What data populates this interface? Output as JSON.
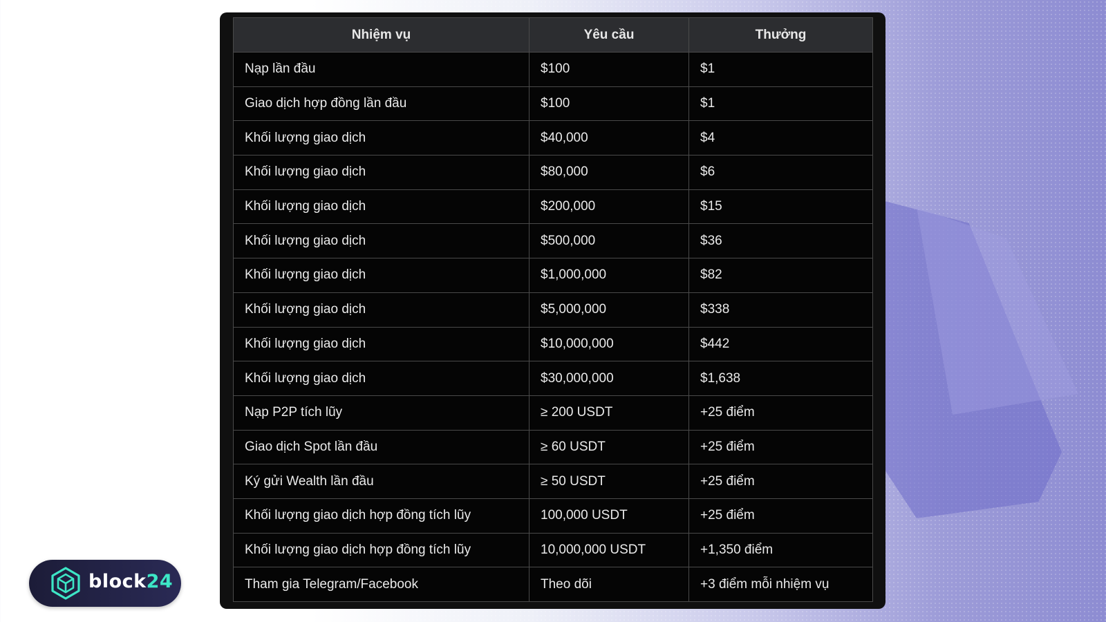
{
  "table": {
    "headers": [
      "Nhiệm vụ",
      "Yêu cầu",
      "Thưởng"
    ],
    "rows": [
      [
        "Nạp lần đầu",
        "$100",
        "$1"
      ],
      [
        "Giao dịch hợp đồng lần đầu",
        "$100",
        "$1"
      ],
      [
        "Khối lượng giao dịch",
        "$40,000",
        "$4"
      ],
      [
        "Khối lượng giao dịch",
        "$80,000",
        "$6"
      ],
      [
        "Khối lượng giao dịch",
        "$200,000",
        "$15"
      ],
      [
        "Khối lượng giao dịch",
        "$500,000",
        "$36"
      ],
      [
        "Khối lượng giao dịch",
        "$1,000,000",
        "$82"
      ],
      [
        "Khối lượng giao dịch",
        "$5,000,000",
        "$338"
      ],
      [
        "Khối lượng giao dịch",
        "$10,000,000",
        "$442"
      ],
      [
        "Khối lượng giao dịch",
        "$30,000,000",
        "$1,638"
      ],
      [
        "Nạp P2P tích lũy",
        "≥ 200 USDT",
        "+25 điểm"
      ],
      [
        "Giao dịch Spot lần đầu",
        "≥ 60 USDT",
        "+25 điểm"
      ],
      [
        "Ký gửi Wealth lần đầu",
        "≥ 50 USDT",
        "+25 điểm"
      ],
      [
        "Khối lượng giao dịch hợp đồng tích lũy",
        "100,000 USDT",
        "+25 điểm"
      ],
      [
        "Khối lượng giao dịch hợp đồng tích lũy",
        "10,000,000 USDT",
        "+1,350 điểm"
      ],
      [
        "Tham gia Telegram/Facebook",
        "Theo dõi",
        "+3 điểm mỗi nhiệm vụ"
      ]
    ]
  },
  "logo": {
    "text_main": "block",
    "text_accent": "24",
    "icon": "cube-hexagon-icon",
    "accent_color": "#3de6c6"
  }
}
